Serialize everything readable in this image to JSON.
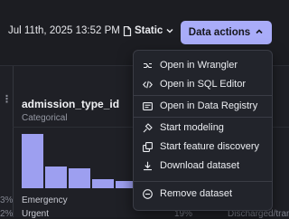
{
  "header": {
    "timestamp": "Jul 11th, 2025 13:52 PM",
    "version_label": "Static",
    "actions_button_label": "Data actions"
  },
  "column": {
    "name": "admission_type_id",
    "type": "Categorical",
    "values": [
      {
        "label": "Emergency",
        "percent": ""
      },
      {
        "label": "Urgent",
        "percent": "19%"
      }
    ],
    "bar_fractions": [
      1.0,
      0.4,
      0.36,
      0.17,
      0.13
    ]
  },
  "left_column": {
    "menu_glyph": "⋮",
    "percents": [
      "3%",
      "2%"
    ]
  },
  "right_column": {
    "cell_text": "Discharged/trans"
  },
  "menu": {
    "items": [
      {
        "label": "Open in Wrangler",
        "icon": "wrangler-icon"
      },
      {
        "label": "Open in SQL Editor",
        "icon": "code-icon"
      },
      {
        "label": "Open in Data Registry",
        "icon": "registry-icon"
      },
      {
        "label": "Start modeling",
        "icon": "modeling-icon"
      },
      {
        "label": "Start feature discovery",
        "icon": "discovery-icon"
      },
      {
        "label": "Download dataset",
        "icon": "download-icon"
      },
      {
        "label": "Remove dataset",
        "icon": "remove-icon"
      }
    ]
  },
  "colors": {
    "accent": "#a9acf9",
    "bar": "#9d9ff0",
    "background": "#1c1d22"
  }
}
